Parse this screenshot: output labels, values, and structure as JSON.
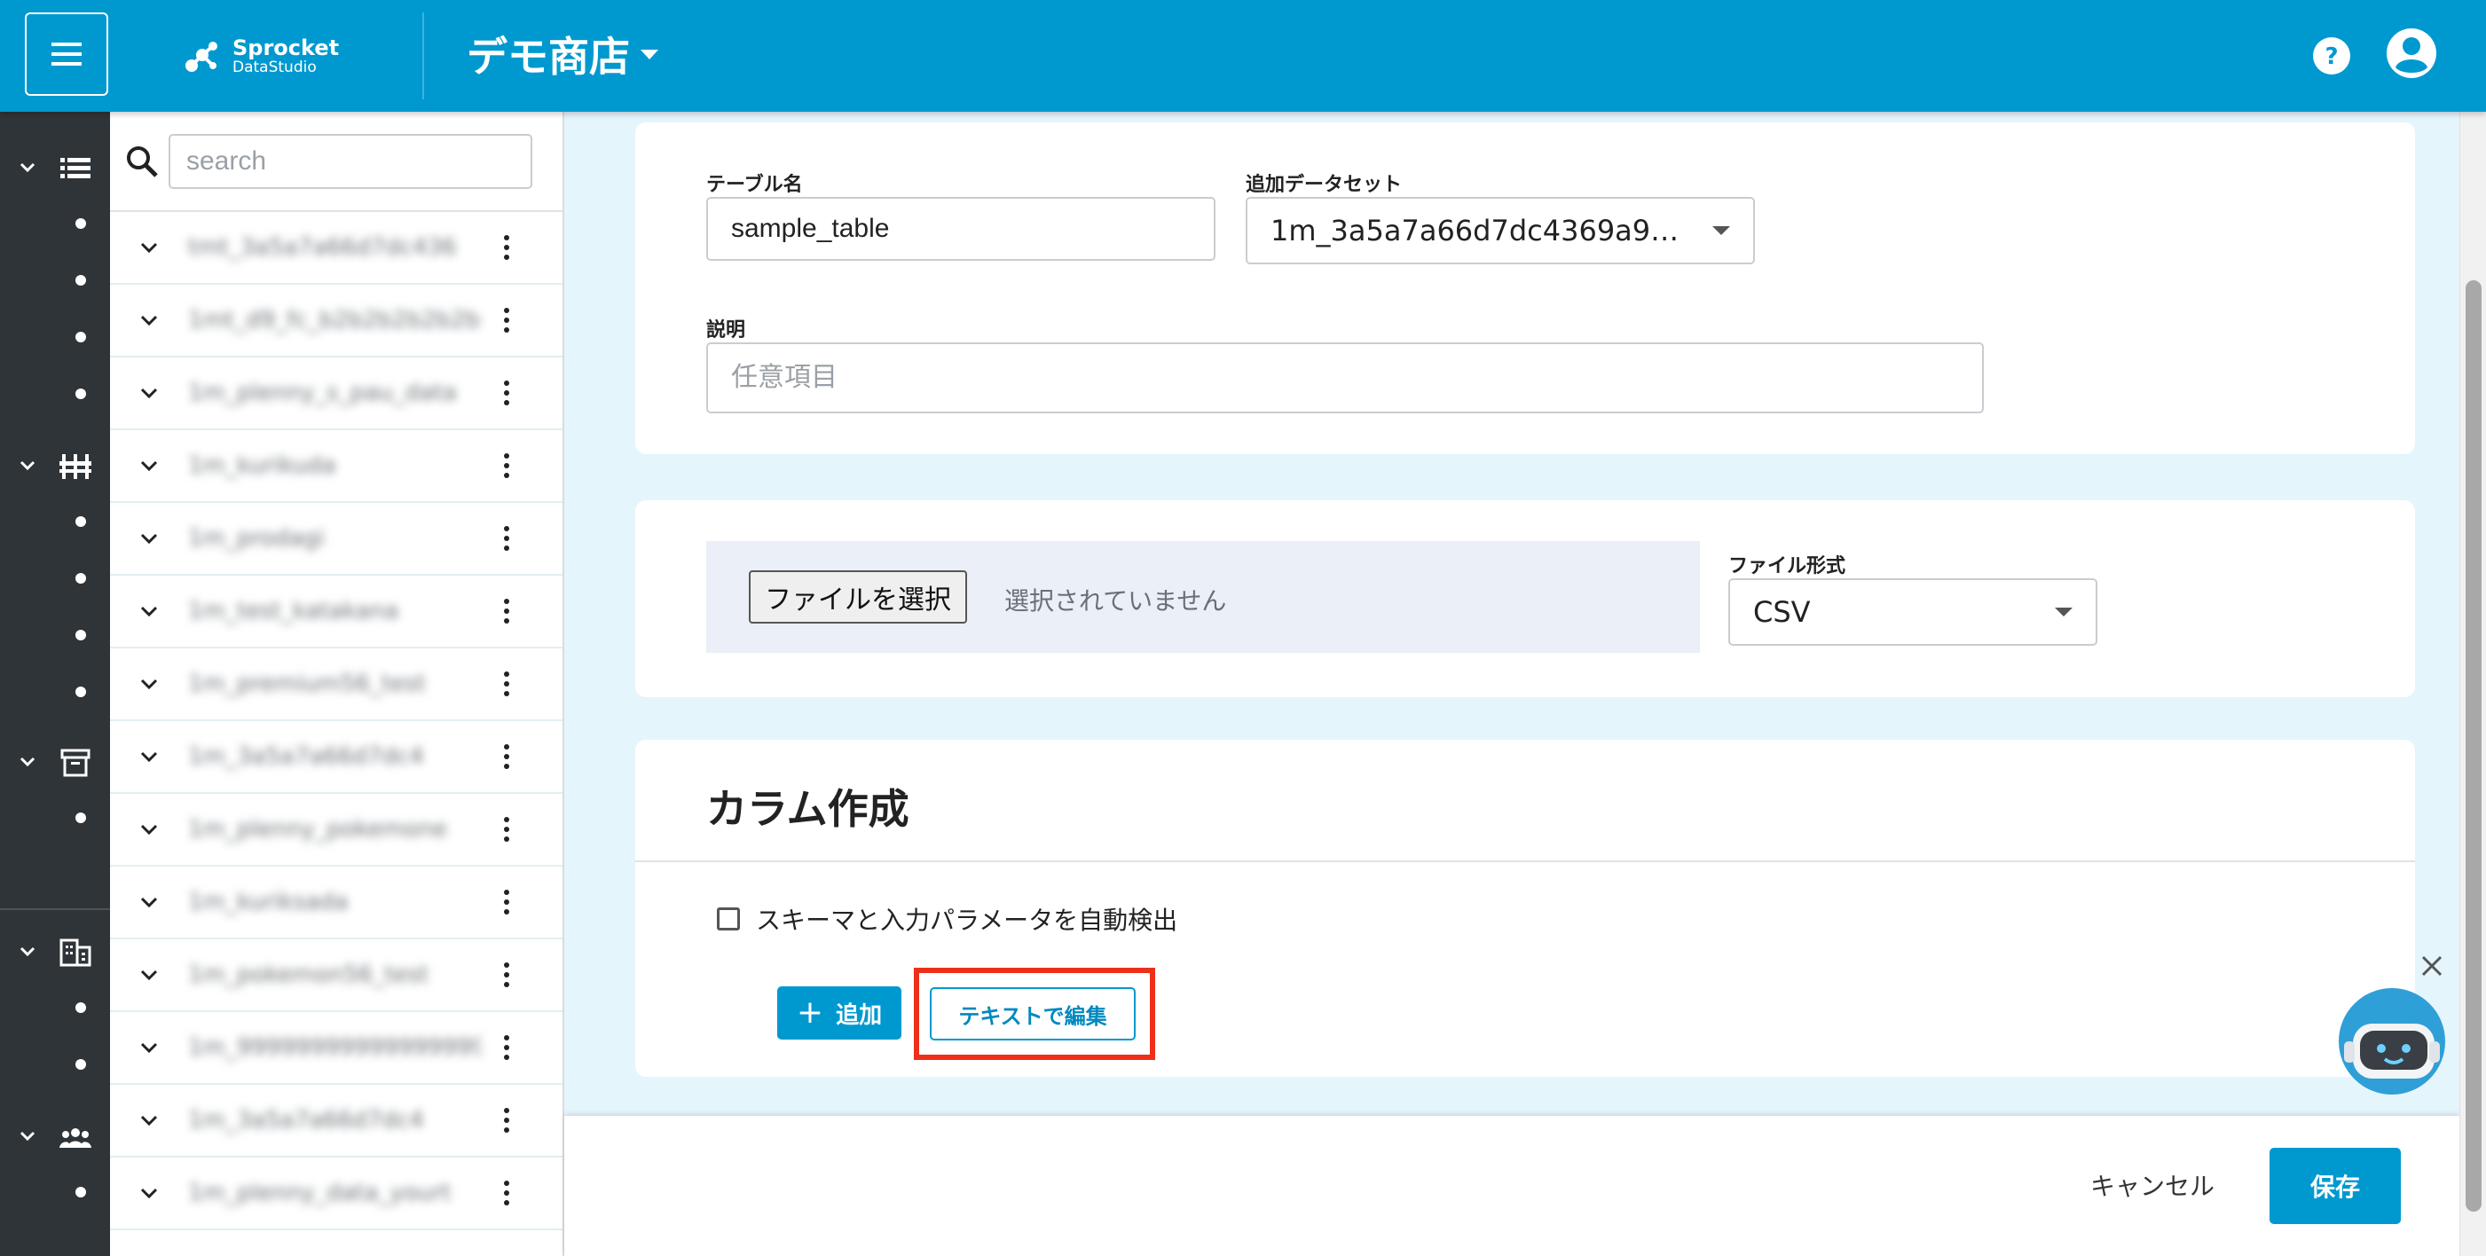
{
  "header": {
    "logo_line1": "Sprocket",
    "logo_line2": "DataStudio",
    "store_name": "デモ商店",
    "brand_color": "#0099cf"
  },
  "search": {
    "placeholder": "search"
  },
  "tree": {
    "items": [
      {
        "label": "tmt_3a5a7a66d7dc436"
      },
      {
        "label": "1mt_d9_fc_b2b2b2b2b2b"
      },
      {
        "label": "1m_plenny_s_pau_data"
      },
      {
        "label": "1m_kurikuda"
      },
      {
        "label": "1m_prodagi"
      },
      {
        "label": "1m_test_katakana"
      },
      {
        "label": "1m_premium56_test"
      },
      {
        "label": "1m_3a5a7a66d7dc4"
      },
      {
        "label": "1m_plenny_pokemone"
      },
      {
        "label": "1m_kuriksada"
      },
      {
        "label": "1m_pokemon56_test"
      },
      {
        "label": "1m_99999999999999999"
      },
      {
        "label": "1m_3a5a7a66d7dc4"
      },
      {
        "label": "1m_plenny_data_yourt"
      }
    ]
  },
  "form": {
    "table_name_label": "テーブル名",
    "table_name_value": "sample_table",
    "dataset_label": "追加データセット",
    "dataset_value": "1m_3a5a7a66d7dc4369a9…",
    "description_label": "説明",
    "description_placeholder": "任意項目",
    "file_button": "ファイルを選択",
    "file_status": "選択されていません",
    "file_format_label": "ファイル形式",
    "file_format_value": "CSV"
  },
  "columns": {
    "title": "カラム作成",
    "autodetect_label": "スキーマと入力パラメータを自動検出",
    "autodetect_checked": false,
    "add_button": "追加",
    "add_icon": "+",
    "text_edit_button": "テキストで編集",
    "highlight_color": "#ee2f1a"
  },
  "footer": {
    "cancel_label": "キャンセル",
    "save_label": "保存"
  }
}
